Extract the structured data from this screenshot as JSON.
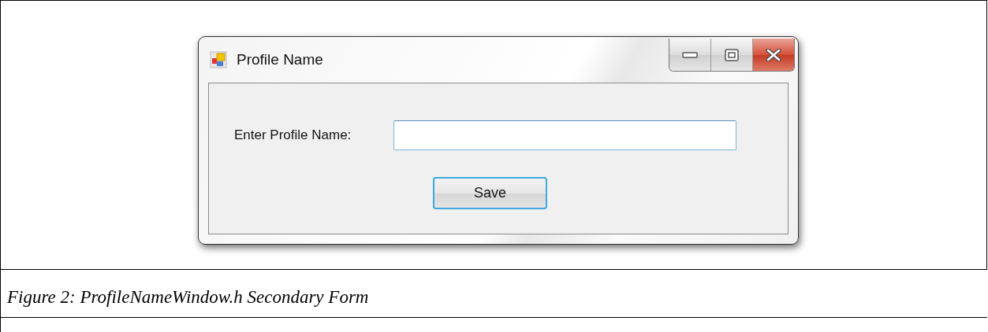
{
  "window": {
    "title": "Profile Name"
  },
  "form": {
    "label": "Enter Profile Name:",
    "button": "Save"
  },
  "caption": "Figure 2: ProfileNameWindow.h Secondary Form"
}
